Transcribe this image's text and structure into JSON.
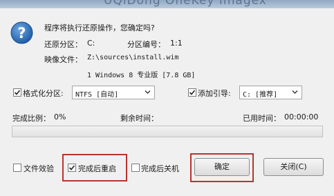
{
  "window": {
    "title": "UQiDong OneKey Imagex"
  },
  "message": {
    "question": "程序将执行还原操作，您确定吗?",
    "restore_partition_label": "还原分区：",
    "restore_partition_value": "C:",
    "partition_number_label": "分区编号：",
    "partition_number_value": "1:1",
    "image_file_label": "映像文件：",
    "image_file_value": "Z:\\sources\\install.wim",
    "image_edition": "1 Windows 8 专业版 [7.8 GB]"
  },
  "format": {
    "label": "格式化分区:",
    "checked": true,
    "value": "NTFS [自动]"
  },
  "boot": {
    "label": "添加引导:",
    "checked": true,
    "value": "C: [推荐]"
  },
  "progress": {
    "complete_label": "完成比例：",
    "complete_value": "0%",
    "remaining_label": "剩余时间：",
    "remaining_value": "",
    "elapsed_label": "已用时间：",
    "elapsed_value": "00:00:00",
    "fraction": 0
  },
  "options": {
    "verify_files": {
      "label": "文件效验",
      "checked": false
    },
    "restart_after": {
      "label": "完成后重启",
      "checked": true
    },
    "shutdown_after": {
      "label": "完成后关机",
      "checked": false
    }
  },
  "buttons": {
    "ok": "确定",
    "close": "关闭(C)"
  },
  "icons": {
    "question": "question-icon",
    "checkmark": "checkmark-icon",
    "dropdown": "chevron-down-icon"
  },
  "colors": {
    "highlight_box": "#b8332f",
    "question_icon": "#1f5fa8",
    "progress_fill": "#06b025"
  }
}
